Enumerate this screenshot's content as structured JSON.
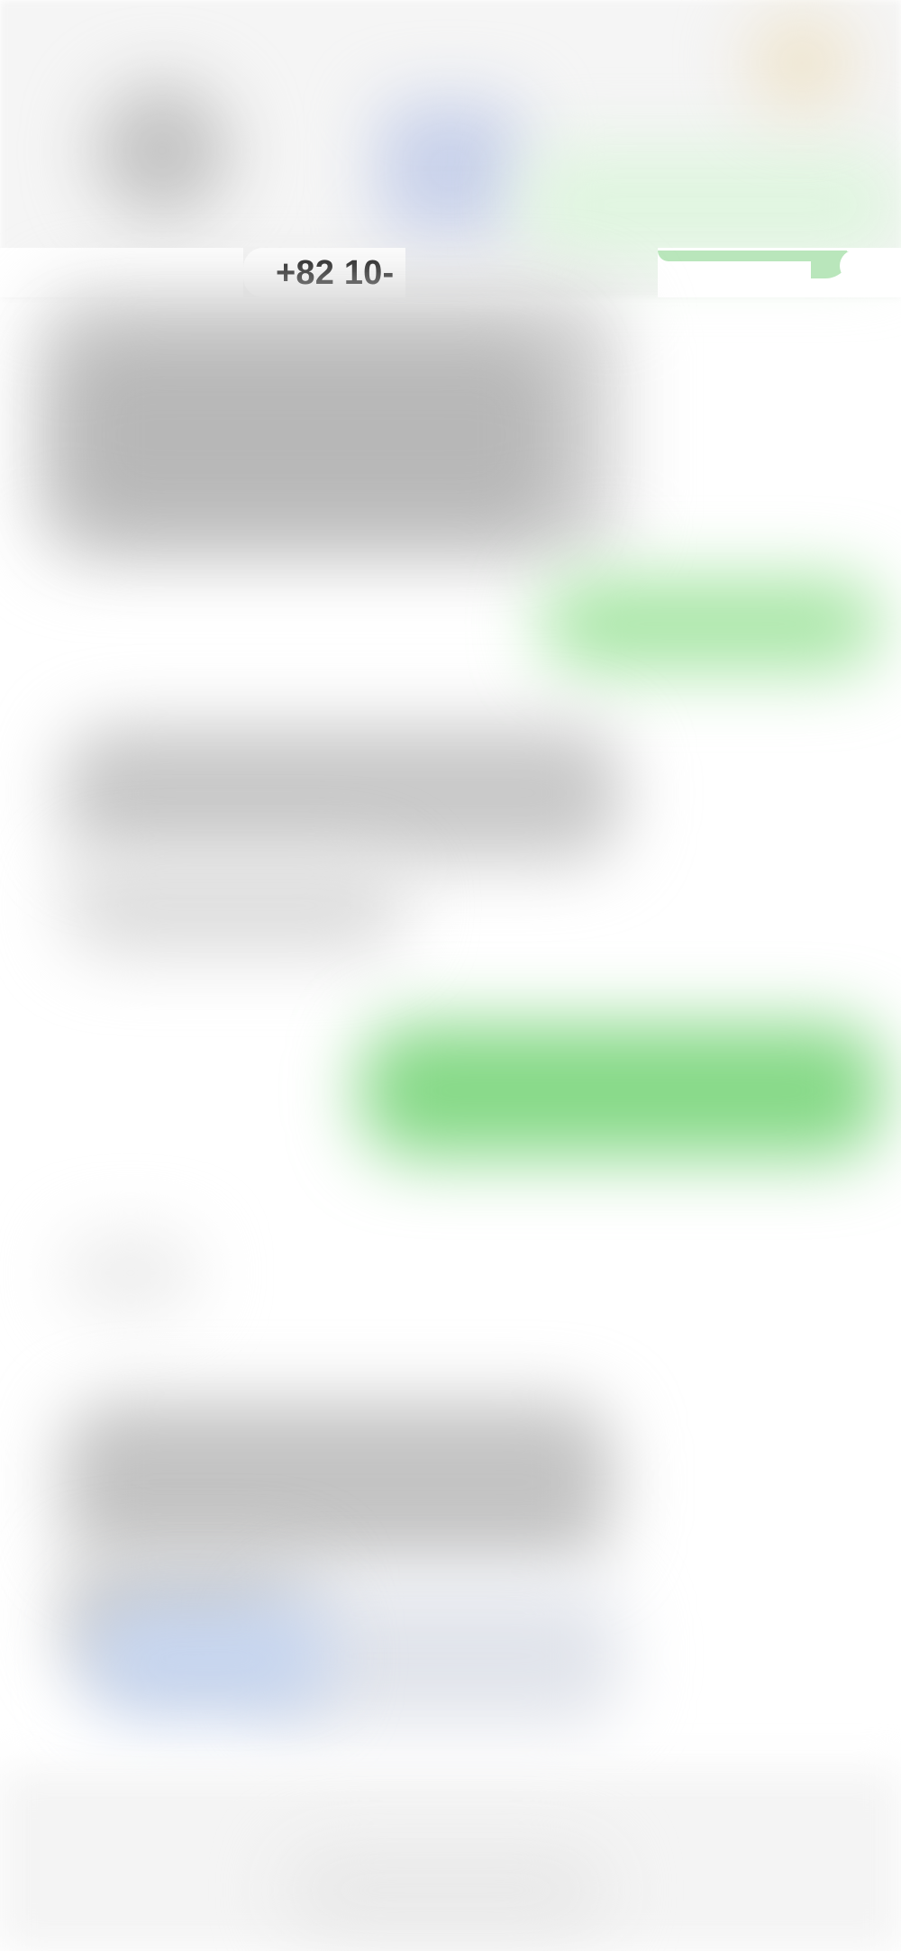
{
  "conversation": {
    "phone_number": "+82 10-"
  },
  "colors": {
    "incoming_bubble": "#bdbdbd",
    "outgoing_bubble": "#93dc8f",
    "attachment_blue": "#c6d5ef",
    "background": "#ffffff"
  }
}
